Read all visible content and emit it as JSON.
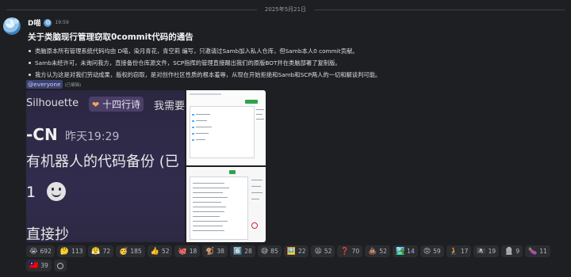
{
  "date_divider": "2025年5月21日",
  "message": {
    "username": "D喵",
    "timestamp": "19:59",
    "title": "关于类脑现行管理窃取0commit代码的通告",
    "bullets": [
      "类脑原本所有管理系统代码均由 D喵，染月青花，青空莉 编写，只邀请过Samb加入私人仓库，但Samb本人0 commit贡献。",
      "Samb未经许可，未询问我方，直接备份仓库源文件，SCP指挥的管理直接踢出我们的原版BOT并在类脑部署了复制版。",
      "我方认为这是对我们劳动成果，版权的窃取，是对创作社区性质的根本羞辱，从现在开始拒绝和Samb和SCP两人的一切和解谈判可能。"
    ],
    "mention": "@everyone",
    "edited": "(已编辑)"
  },
  "attachment_left": {
    "line1_a": "Silhouette",
    "pill_icon": "heart-icon",
    "pill_text": "十四行诗",
    "line1_b": "我需要",
    "cn": "-CN",
    "yesterday": "昨天19:29",
    "backup": "有机器人的代码备份 (已",
    "one": "1",
    "copy": "直接抄"
  },
  "reactions": [
    {
      "emoji": "😭",
      "count": "692"
    },
    {
      "emoji": "🤔",
      "count": "113"
    },
    {
      "emoji": "😤",
      "count": "72"
    },
    {
      "emoji": "🥳",
      "count": "185"
    },
    {
      "emoji": "👍",
      "count": "52"
    },
    {
      "emoji": "🐙",
      "count": "18"
    },
    {
      "emoji": "🐒",
      "count": "38"
    },
    {
      "emoji": "6️⃣",
      "count": "28"
    },
    {
      "emoji": "😅",
      "count": "85"
    },
    {
      "emoji": "🖼️",
      "count": "22"
    },
    {
      "emoji": "😫",
      "count": "52"
    },
    {
      "emoji": "❓",
      "count": "70"
    },
    {
      "emoji": "💩",
      "count": "52"
    },
    {
      "emoji": "🏞️",
      "count": "14"
    },
    {
      "emoji": "😡",
      "count": "59"
    },
    {
      "emoji": "🧎",
      "count": "17"
    },
    {
      "emoji": "🏴‍☠️",
      "count": "19"
    },
    {
      "emoji": "🪦",
      "count": "9"
    },
    {
      "emoji": "🍆",
      "count": "11"
    },
    {
      "emoji": "🇹🇼",
      "count": "39"
    }
  ],
  "colors": {
    "background": "#1e1f22",
    "mention_bg": "#3c4270",
    "reaction_bg": "#2b2d31"
  }
}
